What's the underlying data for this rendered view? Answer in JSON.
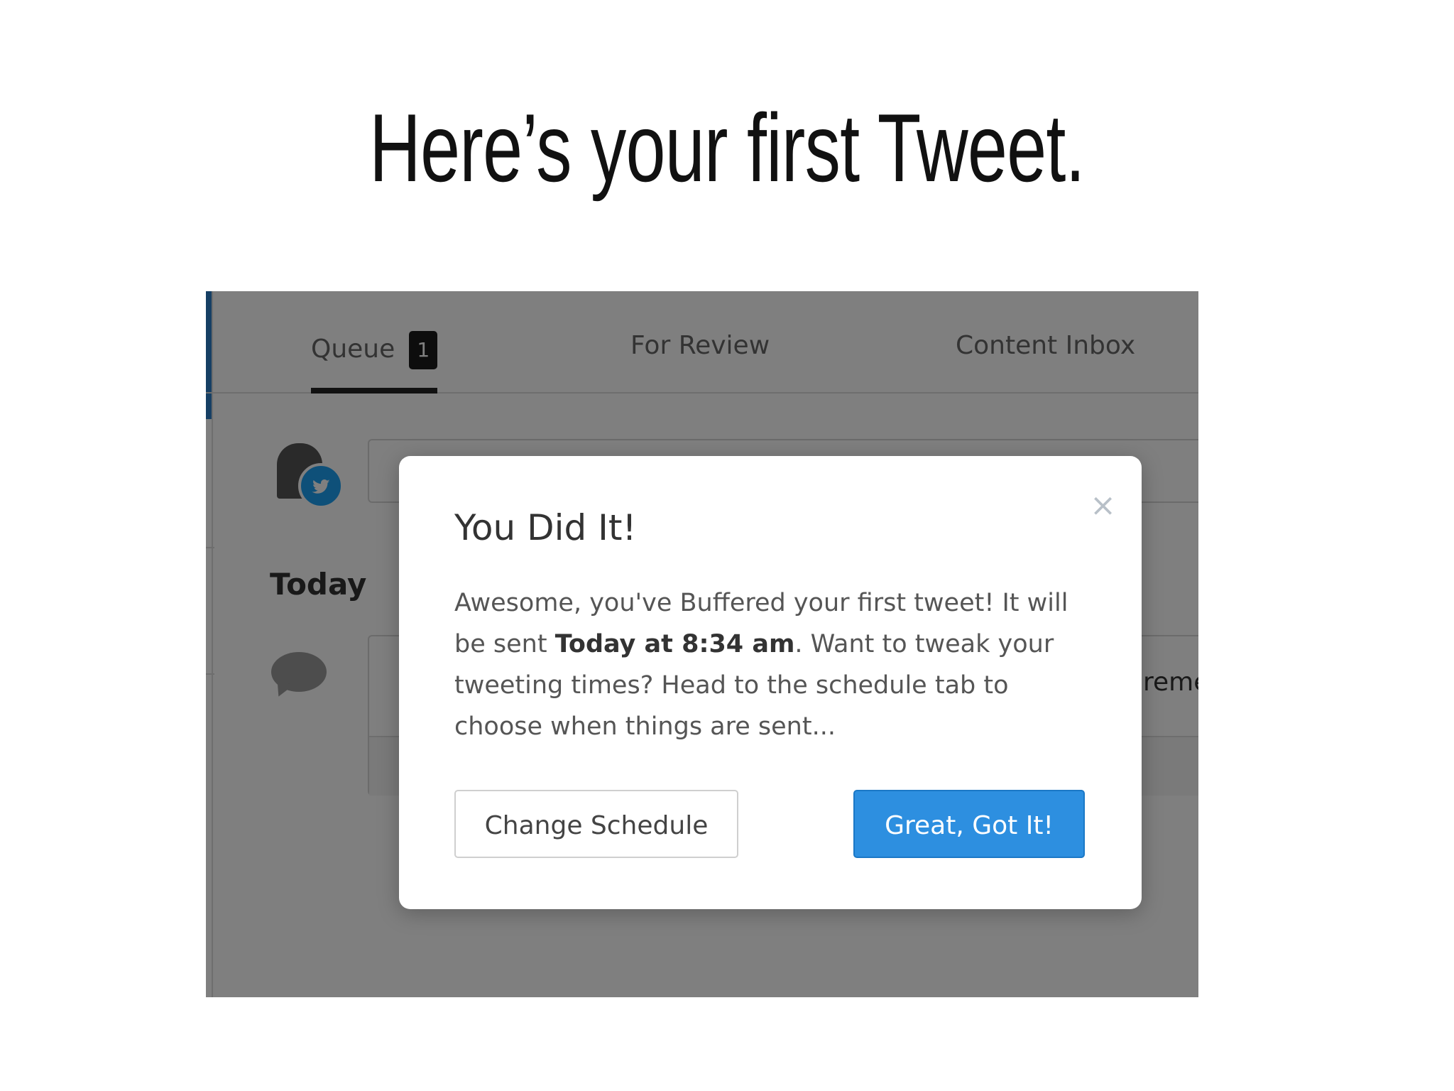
{
  "slide": {
    "title": "Here’s your first Tweet."
  },
  "tabs": [
    {
      "label": "Queue",
      "badge": "1"
    },
    {
      "label": "For Review"
    },
    {
      "label": "Content Inbox"
    }
  ],
  "queue": {
    "section_label": "Today",
    "post_text_fragment": "reme"
  },
  "modal": {
    "close_symbol": "×",
    "title": "You Did It!",
    "body_part1": "Awesome, you've Buffered your first tweet! It will be sent ",
    "body_bold": "Today at 8:34 am",
    "body_part2": ". Want to tweak your tweeting times? Head to the schedule tab to choose when things are sent...",
    "secondary_button": "Change Schedule",
    "primary_button": "Great, Got It!"
  },
  "colors": {
    "primary_button": "#2d8fe0",
    "twitter_badge": "#1da1f2",
    "accent": "#2c7fc9"
  },
  "icons": {
    "twitter": "twitter-icon",
    "comment": "chat-bubble-icon",
    "close": "close-icon"
  }
}
